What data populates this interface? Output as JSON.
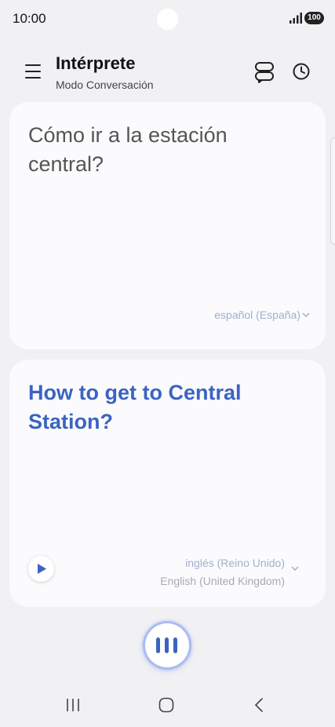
{
  "status_bar": {
    "time": "10:00",
    "battery": "100",
    "signal_icon": "signal-icon"
  },
  "header": {
    "title": "Intérprete",
    "subtitle": "Modo Conversación",
    "menu_icon": "menu-icon",
    "mode_icon": "conversation-mode-icon",
    "history_icon": "history-clock-icon"
  },
  "source_card": {
    "text": "Cómo ir a la estación central?",
    "language": "español (España)"
  },
  "target_card": {
    "text": "How to get to Central Station?",
    "language_native": "inglés (Reino Unido)",
    "language_english": "English (United Kingdom)",
    "play_icon": "play-icon"
  },
  "mic": {
    "icon": "voice-bars-icon"
  },
  "navigation": {
    "recent_icon": "recent-apps-icon",
    "home_icon": "home-icon",
    "back_icon": "back-icon"
  },
  "colors": {
    "accent": "#3c63c2",
    "background": "#f1f1f4",
    "card": "#fbfbfd",
    "language_label": "#9fb0cc"
  }
}
